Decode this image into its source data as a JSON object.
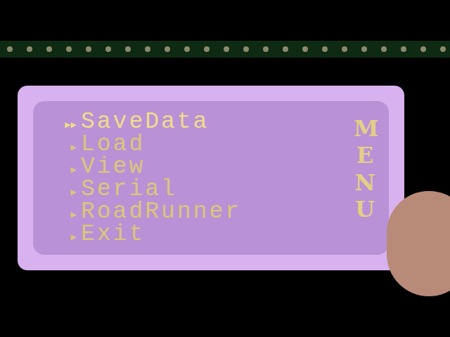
{
  "menu": {
    "title": "MENU",
    "items": [
      {
        "marker": "▶▶",
        "label": "SaveData",
        "selected": true
      },
      {
        "marker": "▶",
        "label": "Load",
        "selected": false
      },
      {
        "marker": "▶",
        "label": "View",
        "selected": false
      },
      {
        "marker": "▶",
        "label": "Serial",
        "selected": false
      },
      {
        "marker": "▶",
        "label": "RoadRunner",
        "selected": false
      },
      {
        "marker": "▶",
        "label": "Exit",
        "selected": false
      }
    ]
  }
}
